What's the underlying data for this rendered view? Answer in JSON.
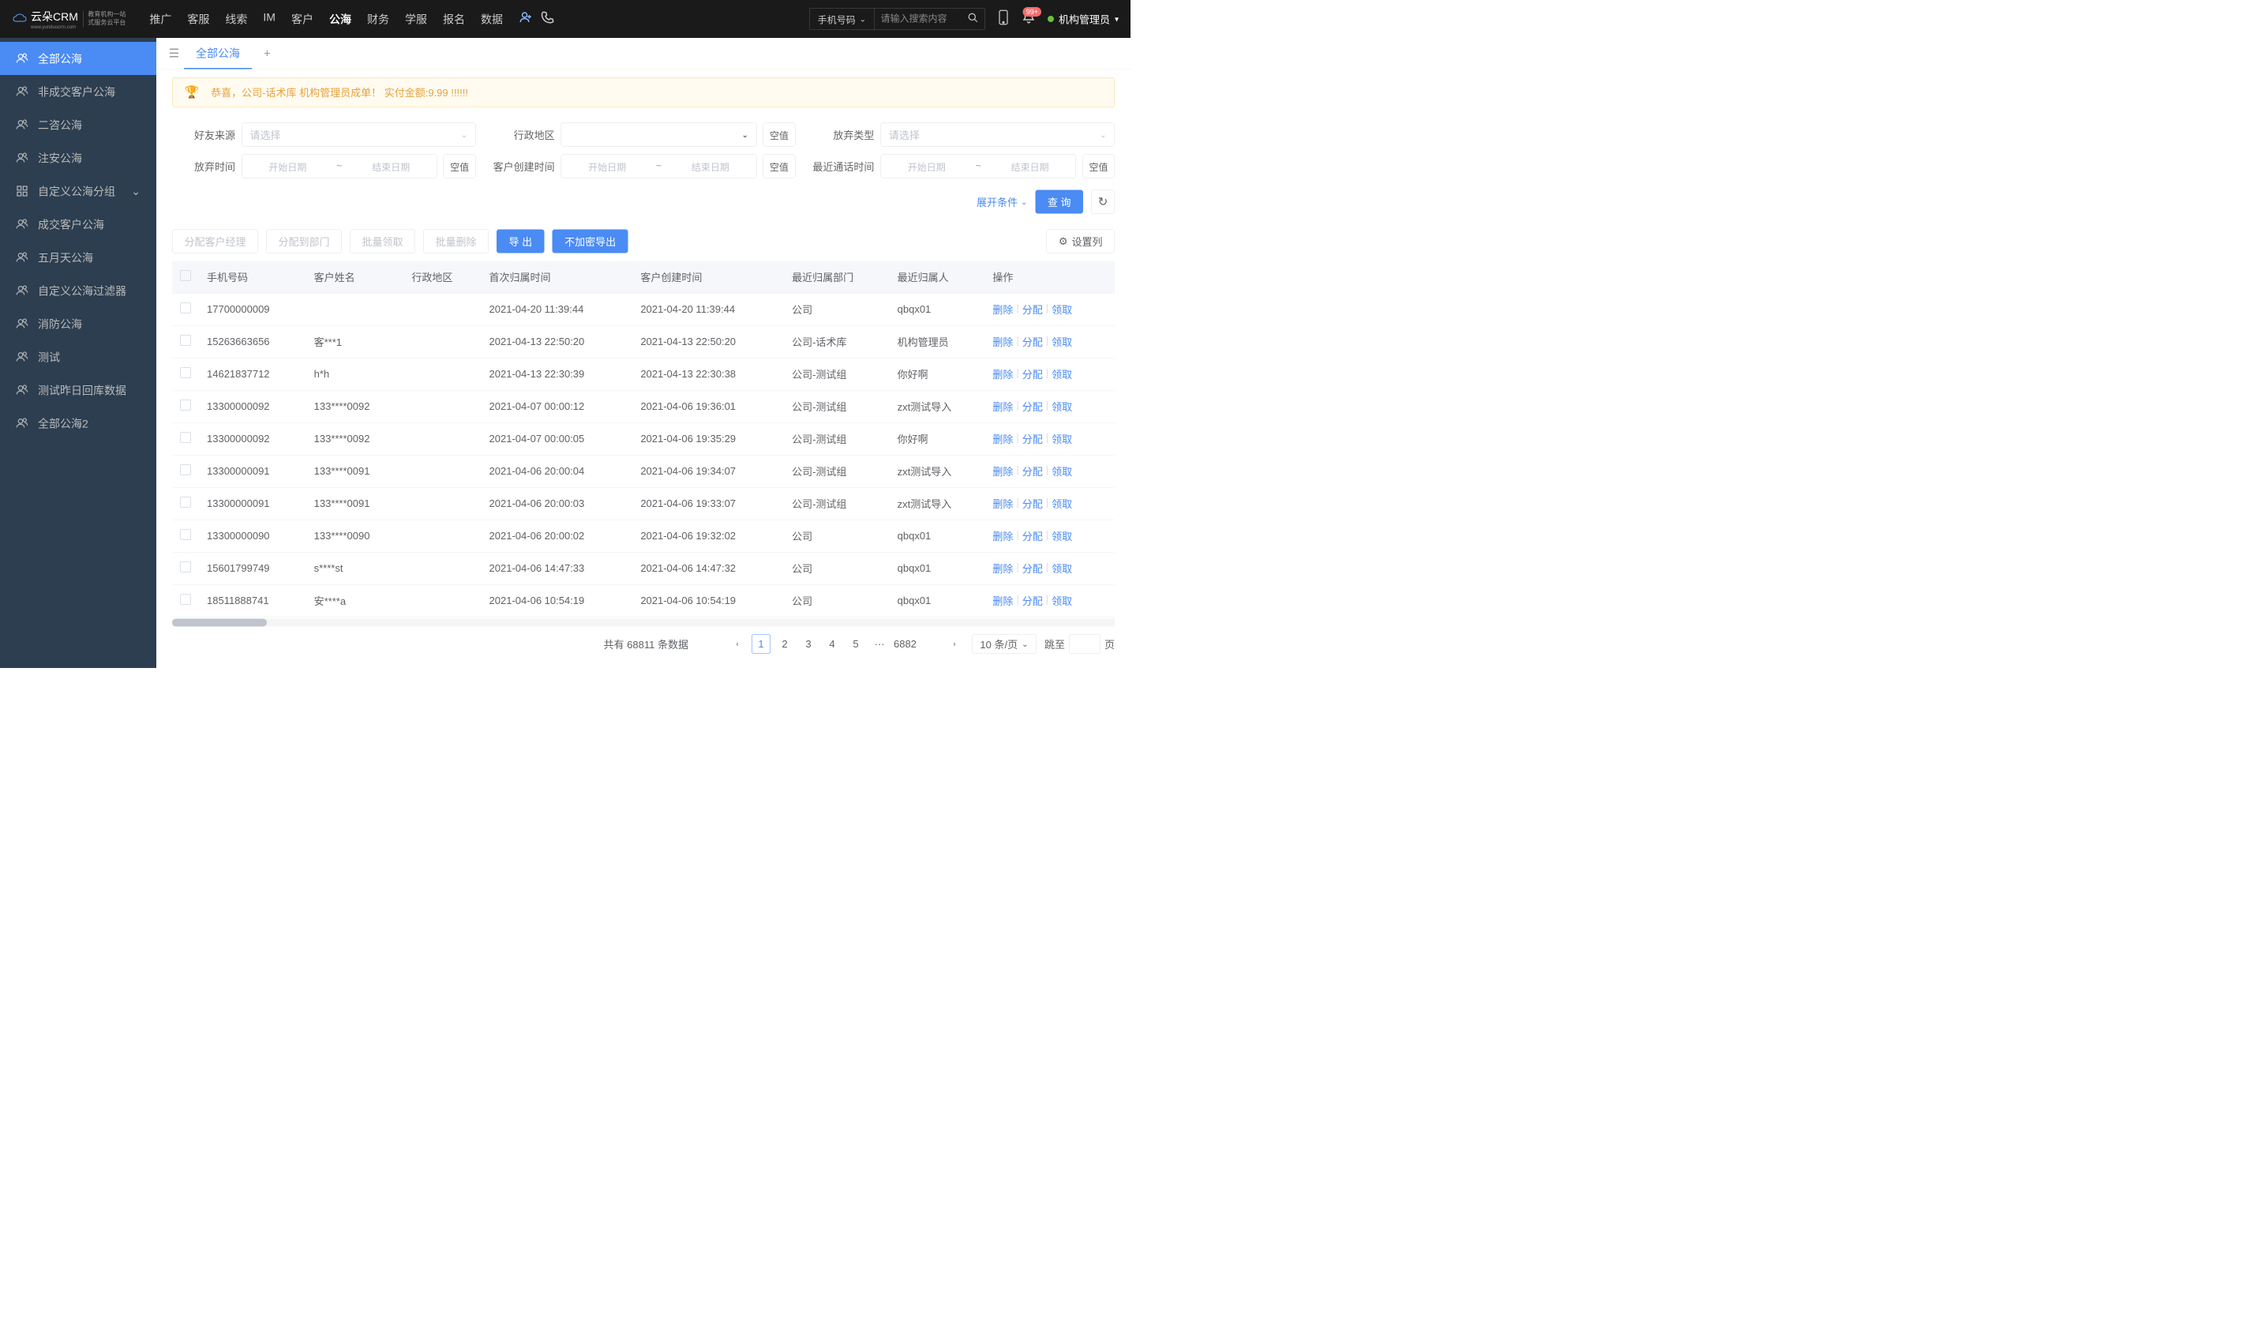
{
  "header": {
    "logo_main": "云朵CRM",
    "logo_url": "www.yunduocrm.com",
    "logo_sub1": "教育机构一站",
    "logo_sub2": "式服务云平台",
    "nav": [
      "推广",
      "客服",
      "线索",
      "IM",
      "客户",
      "公海",
      "财务",
      "学服",
      "报名",
      "数据"
    ],
    "nav_active": 5,
    "search_type": "手机号码",
    "search_placeholder": "请输入搜索内容",
    "notif_badge": "99+",
    "user_name": "机构管理员"
  },
  "sidebar": [
    {
      "label": "全部公海",
      "active": true
    },
    {
      "label": "非成交客户公海"
    },
    {
      "label": "二咨公海"
    },
    {
      "label": "注安公海"
    },
    {
      "label": "自定义公海分组",
      "expand": true
    },
    {
      "label": "成交客户公海"
    },
    {
      "label": "五月天公海"
    },
    {
      "label": "自定义公海过滤器"
    },
    {
      "label": "消防公海"
    },
    {
      "label": "测试"
    },
    {
      "label": "测试昨日回库数据"
    },
    {
      "label": "全部公海2"
    }
  ],
  "tabs": {
    "active": "全部公海"
  },
  "alert": "恭喜，公司-话术库  机构管理员成单！  实付金额:9.99 !!!!!!",
  "filters": {
    "source": {
      "label": "好友来源",
      "placeholder": "请选择"
    },
    "region": {
      "label": "行政地区",
      "empty": "空值"
    },
    "abandon_type": {
      "label": "放弃类型",
      "placeholder": "请选择"
    },
    "abandon_time": {
      "label": "放弃时间",
      "start": "开始日期",
      "end": "结束日期",
      "empty": "空值"
    },
    "create_time": {
      "label": "客户创建时间",
      "start": "开始日期",
      "end": "结束日期",
      "empty": "空值"
    },
    "last_call": {
      "label": "最近通话时间",
      "start": "开始日期",
      "end": "结束日期",
      "empty": "空值"
    },
    "expand": "展开条件",
    "query": "查 询"
  },
  "toolbar": {
    "assign_mgr": "分配客户经理",
    "assign_dept": "分配到部门",
    "batch_claim": "批量领取",
    "batch_delete": "批量删除",
    "export": "导 出",
    "export_plain": "不加密导出",
    "columns": "设置列"
  },
  "table": {
    "headers": [
      "手机号码",
      "客户姓名",
      "行政地区",
      "首次归属时间",
      "客户创建时间",
      "最近归属部门",
      "最近归属人",
      "操作"
    ],
    "ops": {
      "delete": "删除",
      "assign": "分配",
      "claim": "领取"
    },
    "rows": [
      {
        "phone": "17700000009",
        "name": "",
        "region": "",
        "first": "2021-04-20 11:39:44",
        "created": "2021-04-20 11:39:44",
        "dept": "公司",
        "owner": "qbqx01"
      },
      {
        "phone": "15263663656",
        "name": "客***1",
        "region": "",
        "first": "2021-04-13 22:50:20",
        "created": "2021-04-13 22:50:20",
        "dept": "公司-话术库",
        "owner": "机构管理员"
      },
      {
        "phone": "14621837712",
        "name": "h*h",
        "region": "",
        "first": "2021-04-13 22:30:39",
        "created": "2021-04-13 22:30:38",
        "dept": "公司-测试组",
        "owner": "你好啊"
      },
      {
        "phone": "13300000092",
        "name": "133****0092",
        "region": "",
        "first": "2021-04-07 00:00:12",
        "created": "2021-04-06 19:36:01",
        "dept": "公司-测试组",
        "owner": "zxt测试导入"
      },
      {
        "phone": "13300000092",
        "name": "133****0092",
        "region": "",
        "first": "2021-04-07 00:00:05",
        "created": "2021-04-06 19:35:29",
        "dept": "公司-测试组",
        "owner": "你好啊"
      },
      {
        "phone": "13300000091",
        "name": "133****0091",
        "region": "",
        "first": "2021-04-06 20:00:04",
        "created": "2021-04-06 19:34:07",
        "dept": "公司-测试组",
        "owner": "zxt测试导入"
      },
      {
        "phone": "13300000091",
        "name": "133****0091",
        "region": "",
        "first": "2021-04-06 20:00:03",
        "created": "2021-04-06 19:33:07",
        "dept": "公司-测试组",
        "owner": "zxt测试导入"
      },
      {
        "phone": "13300000090",
        "name": "133****0090",
        "region": "",
        "first": "2021-04-06 20:00:02",
        "created": "2021-04-06 19:32:02",
        "dept": "公司",
        "owner": "qbqx01"
      },
      {
        "phone": "15601799749",
        "name": "s****st",
        "region": "",
        "first": "2021-04-06 14:47:33",
        "created": "2021-04-06 14:47:32",
        "dept": "公司",
        "owner": "qbqx01"
      },
      {
        "phone": "18511888741",
        "name": "安****a",
        "region": "",
        "first": "2021-04-06 10:54:19",
        "created": "2021-04-06 10:54:19",
        "dept": "公司",
        "owner": "qbqx01"
      }
    ]
  },
  "pager": {
    "total_prefix": "共有",
    "total": "68811",
    "total_suffix": "条数据",
    "pages": [
      "1",
      "2",
      "3",
      "4",
      "5"
    ],
    "last": "6882",
    "size_label": "10 条/页",
    "jump_label": "跳至",
    "jump_suffix": "页"
  }
}
